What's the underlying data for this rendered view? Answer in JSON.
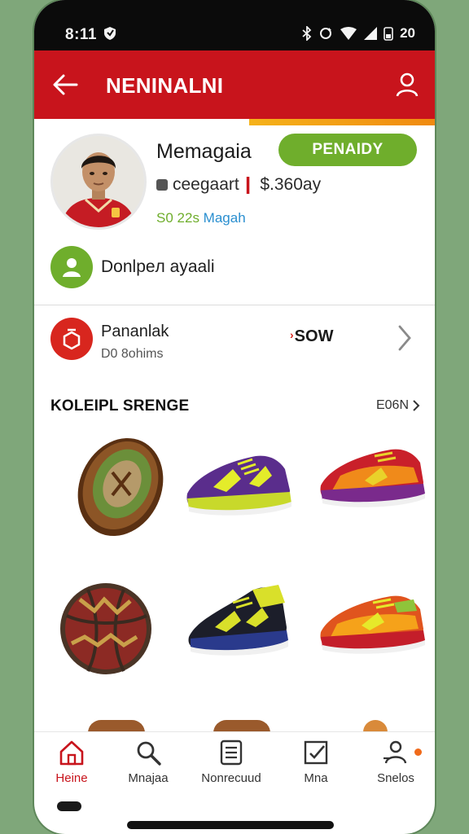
{
  "status_bar": {
    "time": "8:11",
    "battery": "20"
  },
  "app_bar": {
    "title": "NENINALNI"
  },
  "profile": {
    "name": "Memagaia",
    "status_label": "PENAIDY",
    "balance_prefix": "ceegaart",
    "balance_amount": "$.360ay",
    "stats_count": "S0 22",
    "stats_unit": "s",
    "stats_link": "Magah"
  },
  "contact_row": {
    "label": "Donlpeл ayaali"
  },
  "wallet_row": {
    "title": "Pananlak",
    "subtitle": "D0 8ohims",
    "amount": "SOW"
  },
  "collection": {
    "title": "KOLEIPL SRENGE",
    "link_label": "E06N",
    "items": [
      {
        "icon": "wooden-shield-icon"
      },
      {
        "icon": "purple-sneaker-icon"
      },
      {
        "icon": "red-sneaker-icon"
      },
      {
        "icon": "chained-ball-icon"
      },
      {
        "icon": "black-sneaker-icon"
      },
      {
        "icon": "orange-sneaker-icon"
      }
    ]
  },
  "bottom_nav": {
    "items": [
      {
        "label": "Heine",
        "icon": "home-icon",
        "active": true
      },
      {
        "label": "Mnajaa",
        "icon": "search-icon",
        "active": false
      },
      {
        "label": "Nonrecuud",
        "icon": "list-icon",
        "active": false
      },
      {
        "label": "Mna",
        "icon": "checkbox-icon",
        "active": false
      },
      {
        "label": "Snelos",
        "icon": "people-icon",
        "active": false
      }
    ]
  },
  "colors": {
    "brand_red": "#c8141c",
    "accent_green": "#6fae2c",
    "link_blue": "#2a8fd0"
  }
}
